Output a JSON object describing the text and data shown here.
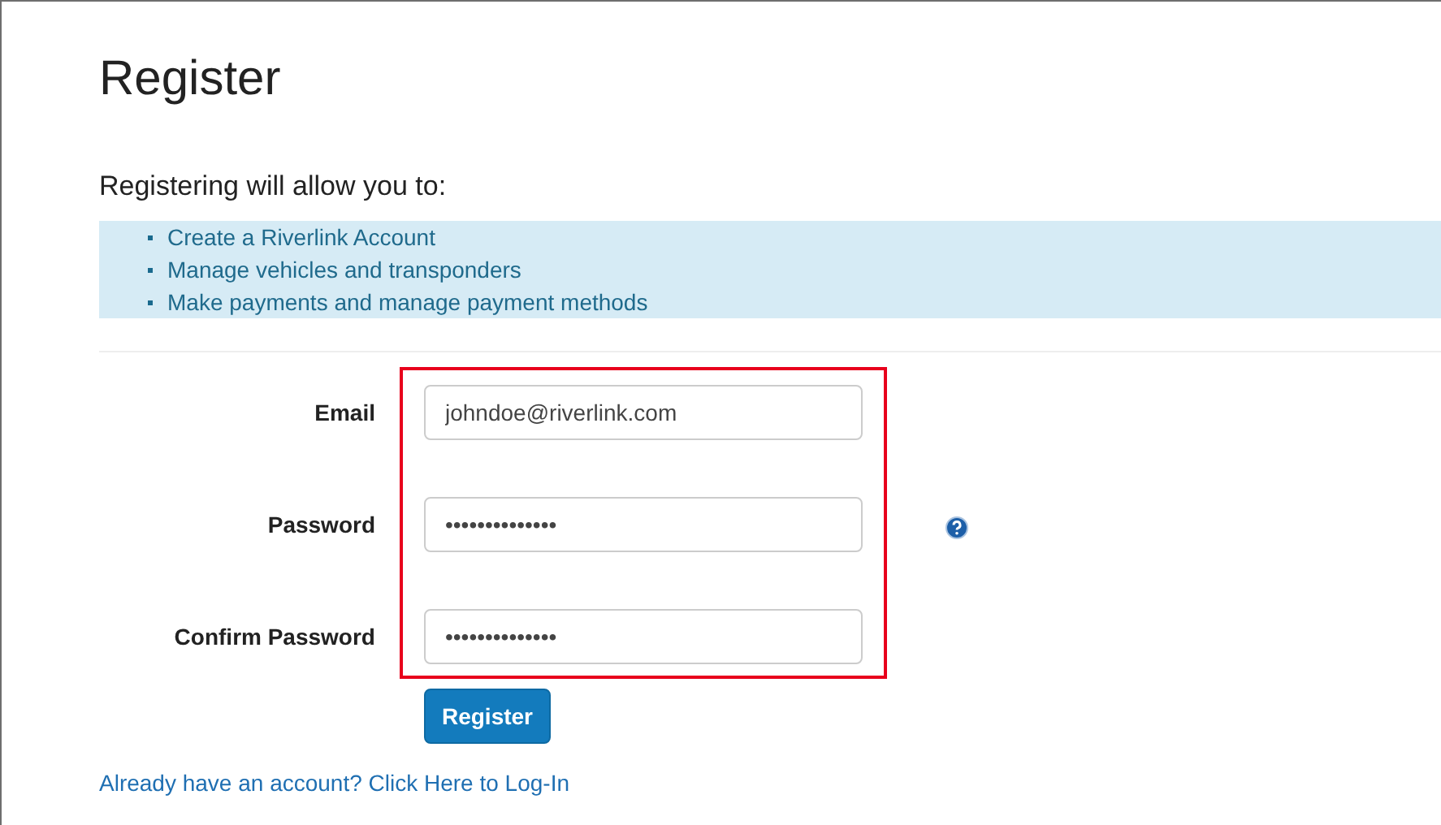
{
  "title": "Register",
  "intro": "Registering will allow you to:",
  "benefits": [
    "Create a Riverlink Account",
    "Manage vehicles and transponders",
    "Make payments and manage payment methods"
  ],
  "form": {
    "highlighted": true,
    "fields": [
      {
        "label": "Email",
        "value": "johndoe@riverlink.com",
        "help": false
      },
      {
        "label": "Password",
        "value": "••••••••••••••",
        "help": true
      },
      {
        "label": "Confirm Password",
        "value": "••••••••••••••",
        "help": false
      }
    ],
    "submit": "Register"
  },
  "login_link": "Already have an account? Click Here to Log-In"
}
